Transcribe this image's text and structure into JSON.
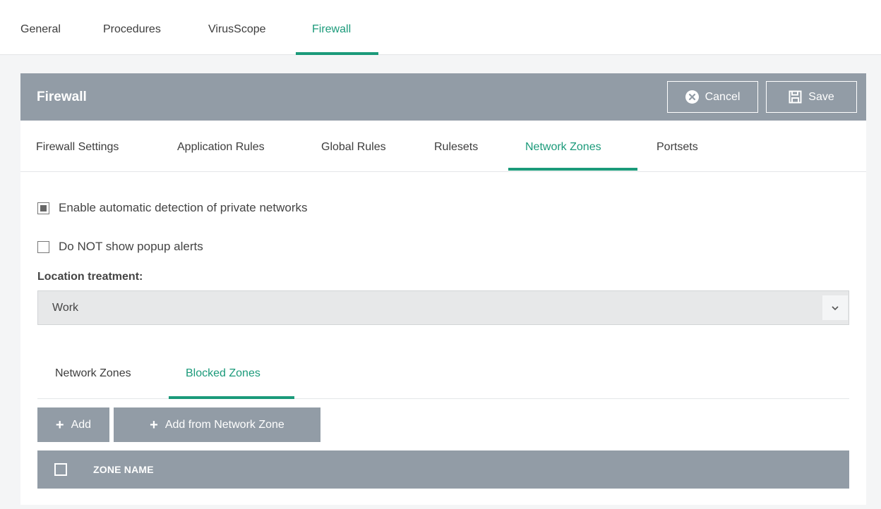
{
  "top_tabs": [
    "General",
    "Procedures",
    "VirusScope",
    "Firewall"
  ],
  "top_active": "Firewall",
  "panel": {
    "title": "Firewall",
    "cancel_label": "Cancel",
    "save_label": "Save"
  },
  "sub_tabs": [
    "Firewall Settings",
    "Application Rules",
    "Global Rules",
    "Rulesets",
    "Network Zones",
    "Portsets"
  ],
  "sub_active": "Network Zones",
  "options": {
    "auto_detect": {
      "label": "Enable automatic detection of private networks",
      "checked": true
    },
    "no_popup": {
      "label": "Do NOT show popup alerts",
      "checked": false
    }
  },
  "location": {
    "label": "Location treatment:",
    "value": "Work"
  },
  "zone_tabs": [
    "Network Zones",
    "Blocked Zones"
  ],
  "zone_active": "Blocked Zones",
  "actions": {
    "add_label": "Add",
    "add_from_label": "Add from Network Zone"
  },
  "table": {
    "columns": [
      "ZONE NAME"
    ]
  },
  "colors": {
    "accent": "#1b9a7a",
    "header_gray": "#929ca6"
  }
}
